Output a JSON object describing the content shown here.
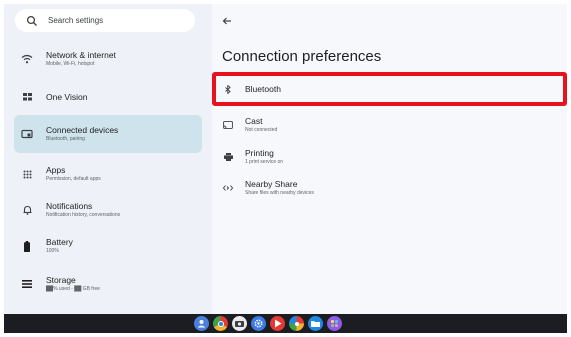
{
  "search": {
    "placeholder": "Search settings"
  },
  "sidebar": {
    "items": [
      {
        "title": "Network & internet",
        "subtitle": "Mobile, Wi-Fi, hotspot",
        "icon": "wifi-icon"
      },
      {
        "title": "One Vision",
        "subtitle": "",
        "icon": "grid-icon"
      },
      {
        "title": "Connected devices",
        "subtitle": "Bluetooth, pairing",
        "icon": "devices-icon",
        "selected": true
      },
      {
        "title": "Apps",
        "subtitle": "Permission, default apps",
        "icon": "apps-icon"
      },
      {
        "title": "Notifications",
        "subtitle": "Notification history, conversations",
        "icon": "bell-icon"
      },
      {
        "title": "Battery",
        "subtitle": "100%",
        "icon": "battery-icon"
      },
      {
        "title": "Storage",
        "subtitle": "██% used - ██ GB free",
        "icon": "storage-icon"
      }
    ]
  },
  "page": {
    "title": "Connection preferences",
    "rows": [
      {
        "title": "Bluetooth",
        "subtitle": "",
        "icon": "bluetooth-icon"
      },
      {
        "title": "Cast",
        "subtitle": "Not connected",
        "icon": "cast-icon"
      },
      {
        "title": "Printing",
        "subtitle": "1 print service on",
        "icon": "printer-icon"
      },
      {
        "title": "Nearby Share",
        "subtitle": "Share files with nearby devices",
        "icon": "nearby-share-icon"
      }
    ]
  },
  "shelf": {
    "apps": [
      {
        "name": "launcher-icon",
        "color": "#4a7fe0"
      },
      {
        "name": "chrome-icon",
        "color": "#f2b230"
      },
      {
        "name": "camera-icon",
        "color": "#5f6368"
      },
      {
        "name": "settings-icon",
        "color": "#3c7be4"
      },
      {
        "name": "play-store-icon",
        "color": "#e53935"
      },
      {
        "name": "photos-icon",
        "color": "#7e57c2"
      },
      {
        "name": "files-icon",
        "color": "#1e88e5"
      },
      {
        "name": "app-icon",
        "color": "#8e5ae8"
      }
    ]
  },
  "colors": {
    "highlight": "#e5131c",
    "selected": "#cfe3ec"
  }
}
